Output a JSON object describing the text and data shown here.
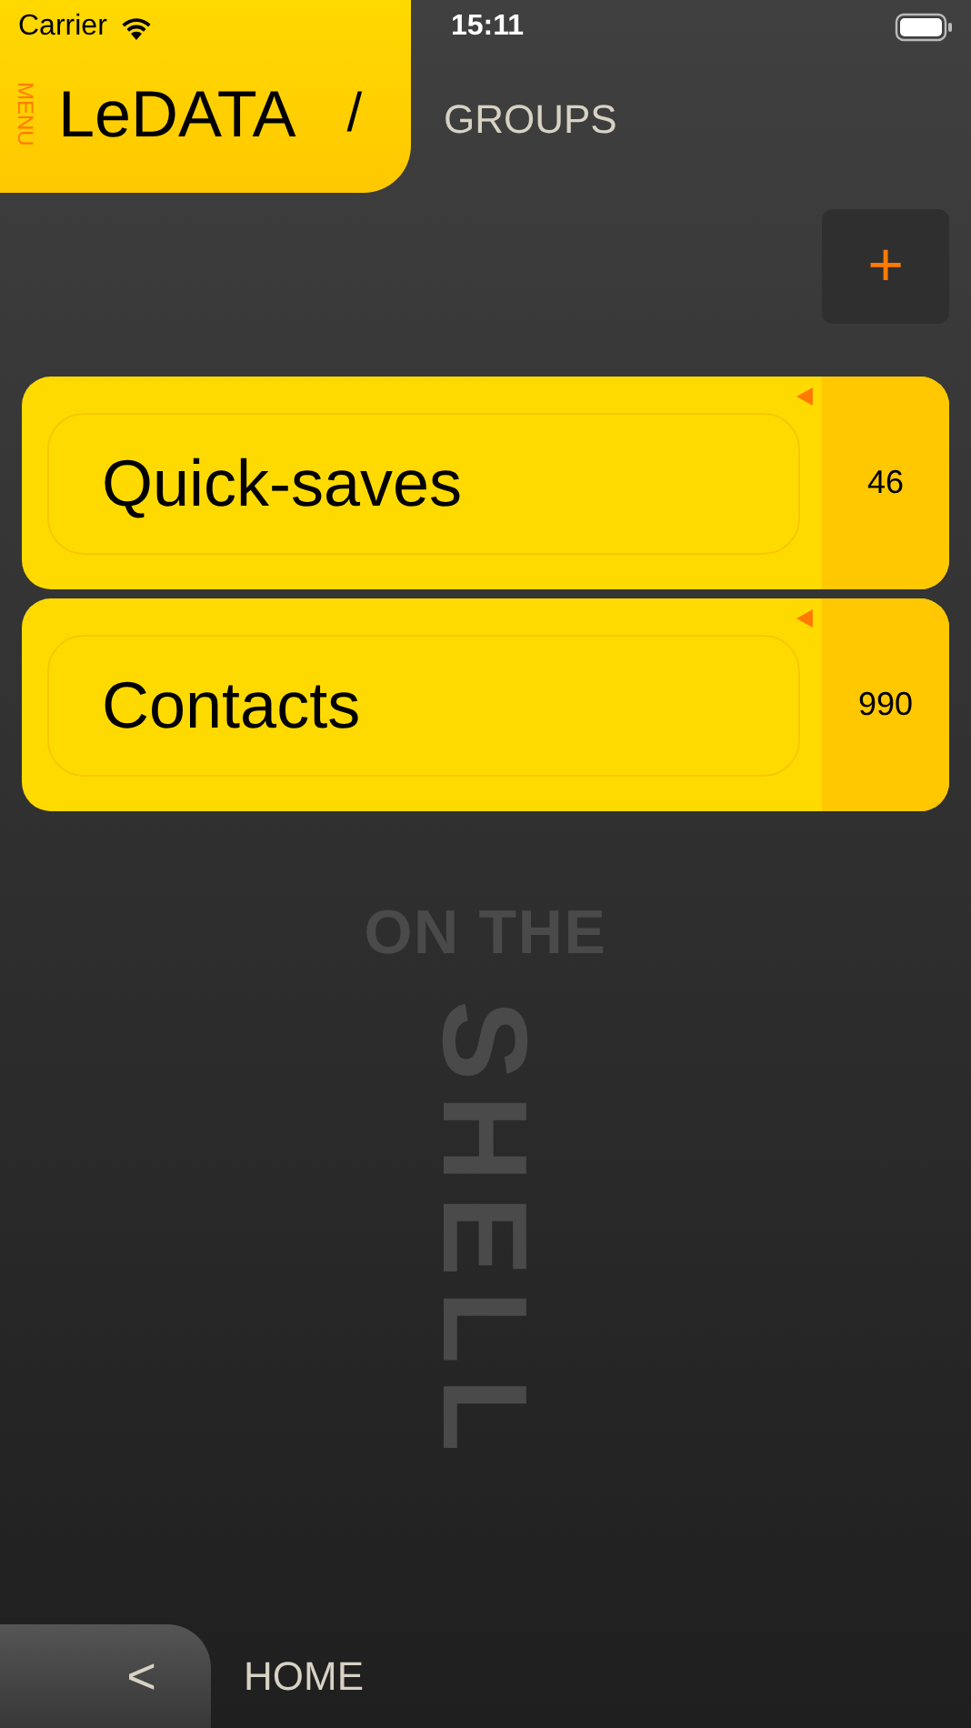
{
  "status_bar": {
    "carrier": "Carrier",
    "time": "15:11"
  },
  "header": {
    "menu_label": "MENU",
    "app_title": "LeDATA",
    "separator": "/",
    "page_title": "GROUPS"
  },
  "add_button": {
    "label": "+"
  },
  "groups": [
    {
      "name": "Quick-saves",
      "count": "46"
    },
    {
      "name": "Contacts",
      "count": "990"
    }
  ],
  "background_logo": {
    "line_1": "ON THE",
    "line_2": "SHELL"
  },
  "footer": {
    "back_label": "<",
    "location": "HOME"
  }
}
